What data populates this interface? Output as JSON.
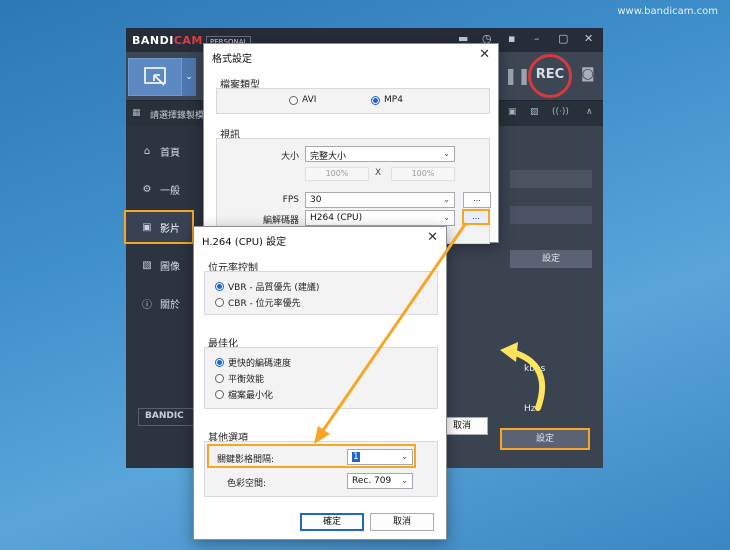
{
  "watermark": "www.bandicam.com",
  "app": {
    "logo_bandi": "BANDI",
    "logo_cam": "CAM",
    "edition": "PERSONAL",
    "rec_label": "REC",
    "toolbar_hint": "請選擇錄製模",
    "sidebar_logo": "BANDIC"
  },
  "sidebar": {
    "items": [
      {
        "label": "首頁",
        "icon": "home-icon"
      },
      {
        "label": "一般",
        "icon": "gear-icon"
      },
      {
        "label": "影片",
        "icon": "video-icon"
      },
      {
        "label": "圖像",
        "icon": "image-icon"
      },
      {
        "label": "關於",
        "icon": "info-icon"
      }
    ]
  },
  "background_panel": {
    "setting_button_1": "設定",
    "setting_button_2": "設定",
    "unit_kbps": "kbps",
    "unit_hz": "Hz",
    "cancel_partial": "取消"
  },
  "format_dialog": {
    "title": "格式設定",
    "file_type_label": "檔案類型",
    "file_types": [
      {
        "label": "AVI",
        "selected": false
      },
      {
        "label": "MP4",
        "selected": true
      }
    ],
    "video_label": "視訊",
    "size_label": "大小",
    "size_value": "完整大小",
    "width_pct": "100%",
    "x_sep": "X",
    "height_pct": "100%",
    "fps_label": "FPS",
    "fps_value": "30",
    "codec_label": "編解碼器",
    "codec_value": "H264 (CPU)",
    "more_button": "..."
  },
  "h264_dialog": {
    "title": "H.264 (CPU) 設定",
    "bitrate_group": "位元率控制",
    "bitrate_options": [
      {
        "label": "VBR - 品質優先 (建議)",
        "selected": true
      },
      {
        "label": "CBR - 位元率優先",
        "selected": false
      }
    ],
    "optimize_group": "最佳化",
    "optimize_options": [
      {
        "label": "更快的編碼速度",
        "selected": true
      },
      {
        "label": "平衡效能",
        "selected": false
      },
      {
        "label": "檔案最小化",
        "selected": false
      }
    ],
    "other_group": "其他選項",
    "keyframe_label": "關鍵影格間隔:",
    "keyframe_value": "1",
    "colorspace_label": "色彩空間:",
    "colorspace_value": "Rec. 709",
    "ok_button": "確定",
    "cancel_button": "取消"
  },
  "colors": {
    "highlight": "#f6a623",
    "rec_ring": "#d8393a",
    "accent_blue": "#1e66c9"
  }
}
